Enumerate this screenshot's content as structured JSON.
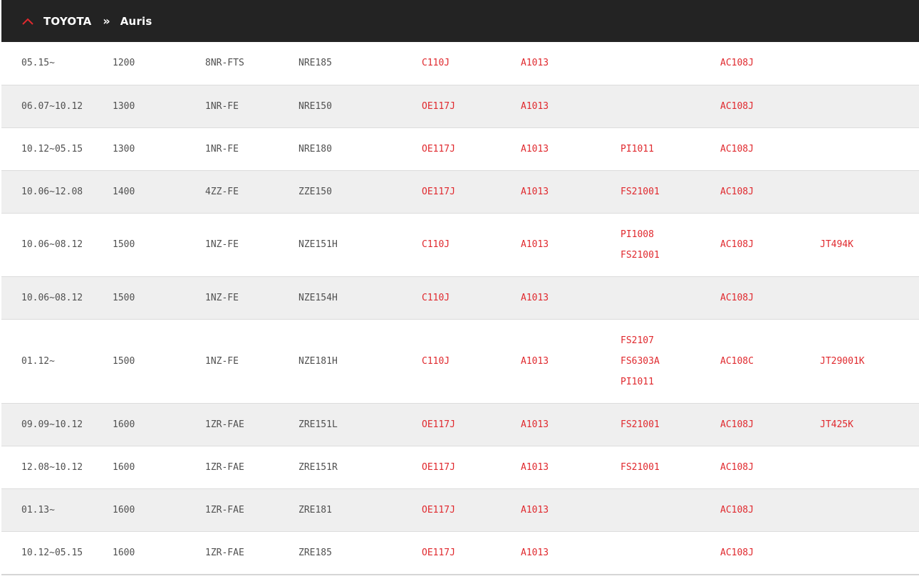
{
  "breadcrumb": {
    "make": "TOYOTA",
    "separator": "»",
    "model": "Auris",
    "toggle_icon": "chevron-up-icon",
    "accent_color": "#e0292e"
  },
  "rows": [
    {
      "period": "05.15~",
      "cc": "1200",
      "engine": "8NR-FTS",
      "chassis": "NRE185",
      "oil": [
        "C110J"
      ],
      "air": [
        "A1013"
      ],
      "fuel": [],
      "cabin": [
        "AC108J"
      ],
      "other": []
    },
    {
      "period": "06.07~10.12",
      "cc": "1300",
      "engine": "1NR-FE",
      "chassis": "NRE150",
      "oil": [
        "OE117J"
      ],
      "air": [
        "A1013"
      ],
      "fuel": [],
      "cabin": [
        "AC108J"
      ],
      "other": []
    },
    {
      "period": "10.12~05.15",
      "cc": "1300",
      "engine": "1NR-FE",
      "chassis": "NRE180",
      "oil": [
        "OE117J"
      ],
      "air": [
        "A1013"
      ],
      "fuel": [
        "PI1011"
      ],
      "cabin": [
        "AC108J"
      ],
      "other": []
    },
    {
      "period": "10.06~12.08",
      "cc": "1400",
      "engine": "4ZZ-FE",
      "chassis": "ZZE150",
      "oil": [
        "OE117J"
      ],
      "air": [
        "A1013"
      ],
      "fuel": [
        "FS21001"
      ],
      "cabin": [
        "AC108J"
      ],
      "other": []
    },
    {
      "period": "10.06~08.12",
      "cc": "1500",
      "engine": "1NZ-FE",
      "chassis": "NZE151H",
      "oil": [
        "C110J"
      ],
      "air": [
        "A1013"
      ],
      "fuel": [
        "PI1008",
        "FS21001"
      ],
      "cabin": [
        "AC108J"
      ],
      "other": [
        "JT494K"
      ]
    },
    {
      "period": "10.06~08.12",
      "cc": "1500",
      "engine": "1NZ-FE",
      "chassis": "NZE154H",
      "oil": [
        "C110J"
      ],
      "air": [
        "A1013"
      ],
      "fuel": [],
      "cabin": [
        "AC108J"
      ],
      "other": []
    },
    {
      "period": "01.12~",
      "cc": "1500",
      "engine": "1NZ-FE",
      "chassis": "NZE181H",
      "oil": [
        "C110J"
      ],
      "air": [
        "A1013"
      ],
      "fuel": [
        "FS2107",
        "FS6303A",
        "PI1011"
      ],
      "cabin": [
        "AC108C"
      ],
      "other": [
        "JT29001K"
      ]
    },
    {
      "period": "09.09~10.12",
      "cc": "1600",
      "engine": "1ZR-FAE",
      "chassis": "ZRE151L",
      "oil": [
        "OE117J"
      ],
      "air": [
        "A1013"
      ],
      "fuel": [
        "FS21001"
      ],
      "cabin": [
        "AC108J"
      ],
      "other": [
        "JT425K"
      ]
    },
    {
      "period": "12.08~10.12",
      "cc": "1600",
      "engine": "1ZR-FAE",
      "chassis": "ZRE151R",
      "oil": [
        "OE117J"
      ],
      "air": [
        "A1013"
      ],
      "fuel": [
        "FS21001"
      ],
      "cabin": [
        "AC108J"
      ],
      "other": []
    },
    {
      "period": "01.13~",
      "cc": "1600",
      "engine": "1ZR-FAE",
      "chassis": "ZRE181",
      "oil": [
        "OE117J"
      ],
      "air": [
        "A1013"
      ],
      "fuel": [],
      "cabin": [
        "AC108J"
      ],
      "other": []
    },
    {
      "period": "10.12~05.15",
      "cc": "1600",
      "engine": "1ZR-FAE",
      "chassis": "ZRE185",
      "oil": [
        "OE117J"
      ],
      "air": [
        "A1013"
      ],
      "fuel": [],
      "cabin": [
        "AC108J"
      ],
      "other": []
    }
  ]
}
